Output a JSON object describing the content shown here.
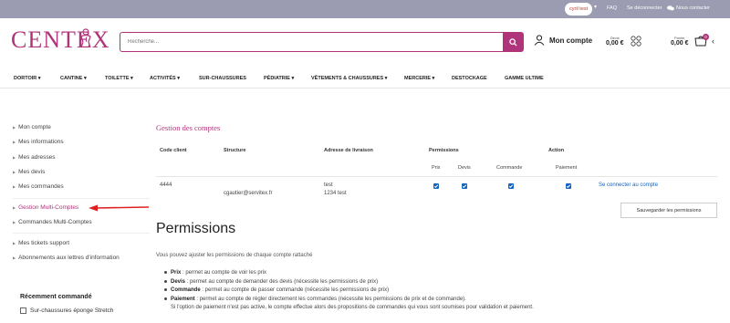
{
  "topbar": {
    "user": "cyril test",
    "logout": "Se déconnecter",
    "faq": "FAQ",
    "contact": "Nous contacter"
  },
  "header": {
    "logo": "CENTEX",
    "search_placeholder": "Recherche...",
    "account_label": "Mon compte",
    "quote": {
      "label": "Devis",
      "value": "0,00 €"
    },
    "cart": {
      "label": "Panier",
      "value": "0,00 €",
      "count": "0"
    }
  },
  "nav": [
    "DORTOIR",
    "CANTINE",
    "TOILETTE",
    "ACTIVITÉS",
    "SUR-CHAUSSURES",
    "PÉDIATRIE",
    "VÊTEMENTS & CHAUSSURES",
    "MERCERIE",
    "DESTOCKAGE",
    "GAMME ULTIME"
  ],
  "sidebar": {
    "items": [
      "Mon compte",
      "Mes informations",
      "Mes adresses",
      "Mes devis",
      "Mes commandes",
      "Gestion Multi-Comptes",
      "Commandes Multi-Comptes",
      "Mes tickets support",
      "Abonnements aux lettres d'information"
    ],
    "recent_title": "Récemment commandé",
    "recent_item": "Sur-chaussures éponge Stretch"
  },
  "accounts": {
    "title": "Gestion des comptes",
    "headers": {
      "code": "Code client",
      "structure": "Structure",
      "address": "Adresse de livraison",
      "permissions": "Permissions",
      "action": "Action"
    },
    "subheaders": [
      "Prix",
      "Devis",
      "Commande",
      "Paiement"
    ],
    "row": {
      "code": "4444",
      "structure": "cgautier@servitex.fr",
      "address_line1": "test",
      "address_line2": "1234 test",
      "perms": [
        true,
        true,
        true,
        true
      ],
      "action": "Se connecter au compte"
    },
    "save": "Sauvegarder les permissions"
  },
  "permissions": {
    "title": "Permissions",
    "intro": "Vous pouvez ajuster les permissions de chaque compte rattaché",
    "items": [
      {
        "name": "Prix",
        "text": " : permet au compte de voir les prix"
      },
      {
        "name": "Devis",
        "text": " : permet au compte de demander des devis (nécessite les permissions de prix)"
      },
      {
        "name": "Commande",
        "text": " : permet au compte de passer commande (nécessite les permissions de prix)"
      },
      {
        "name": "Paiement",
        "text": " : permet au compte de régler directement les commandes (nécessite les permissions de prix et de commande)."
      }
    ],
    "note": "Si l'option de paiement n'est pas active, le compte effectue alors des propositions de commandes qui vous sont soumises pour validation et paiement."
  },
  "colors": {
    "brand": "#b0347a",
    "link": "#1565c0",
    "topbar": "#9b9bb1"
  }
}
